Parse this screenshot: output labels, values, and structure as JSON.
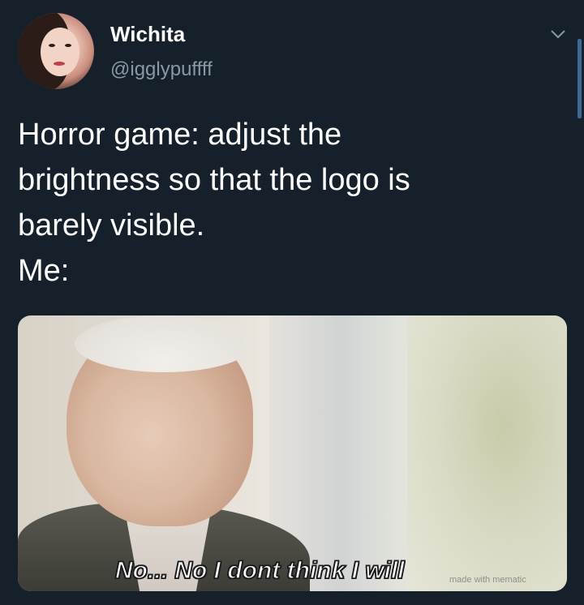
{
  "tweet": {
    "display_name": "Wichita",
    "handle": "@igglypuffff",
    "text_lines": [
      "Horror game: adjust the",
      "brightness so that the logo is",
      "barely visible.",
      "Me:"
    ],
    "menu_icon": "chevron-down-icon"
  },
  "media": {
    "subtitle": "No... No I dont think I will",
    "watermark": "made with mematic"
  },
  "colors": {
    "background": "#15202b",
    "secondary_text": "#8899a6",
    "primary_text": "#ffffff"
  }
}
